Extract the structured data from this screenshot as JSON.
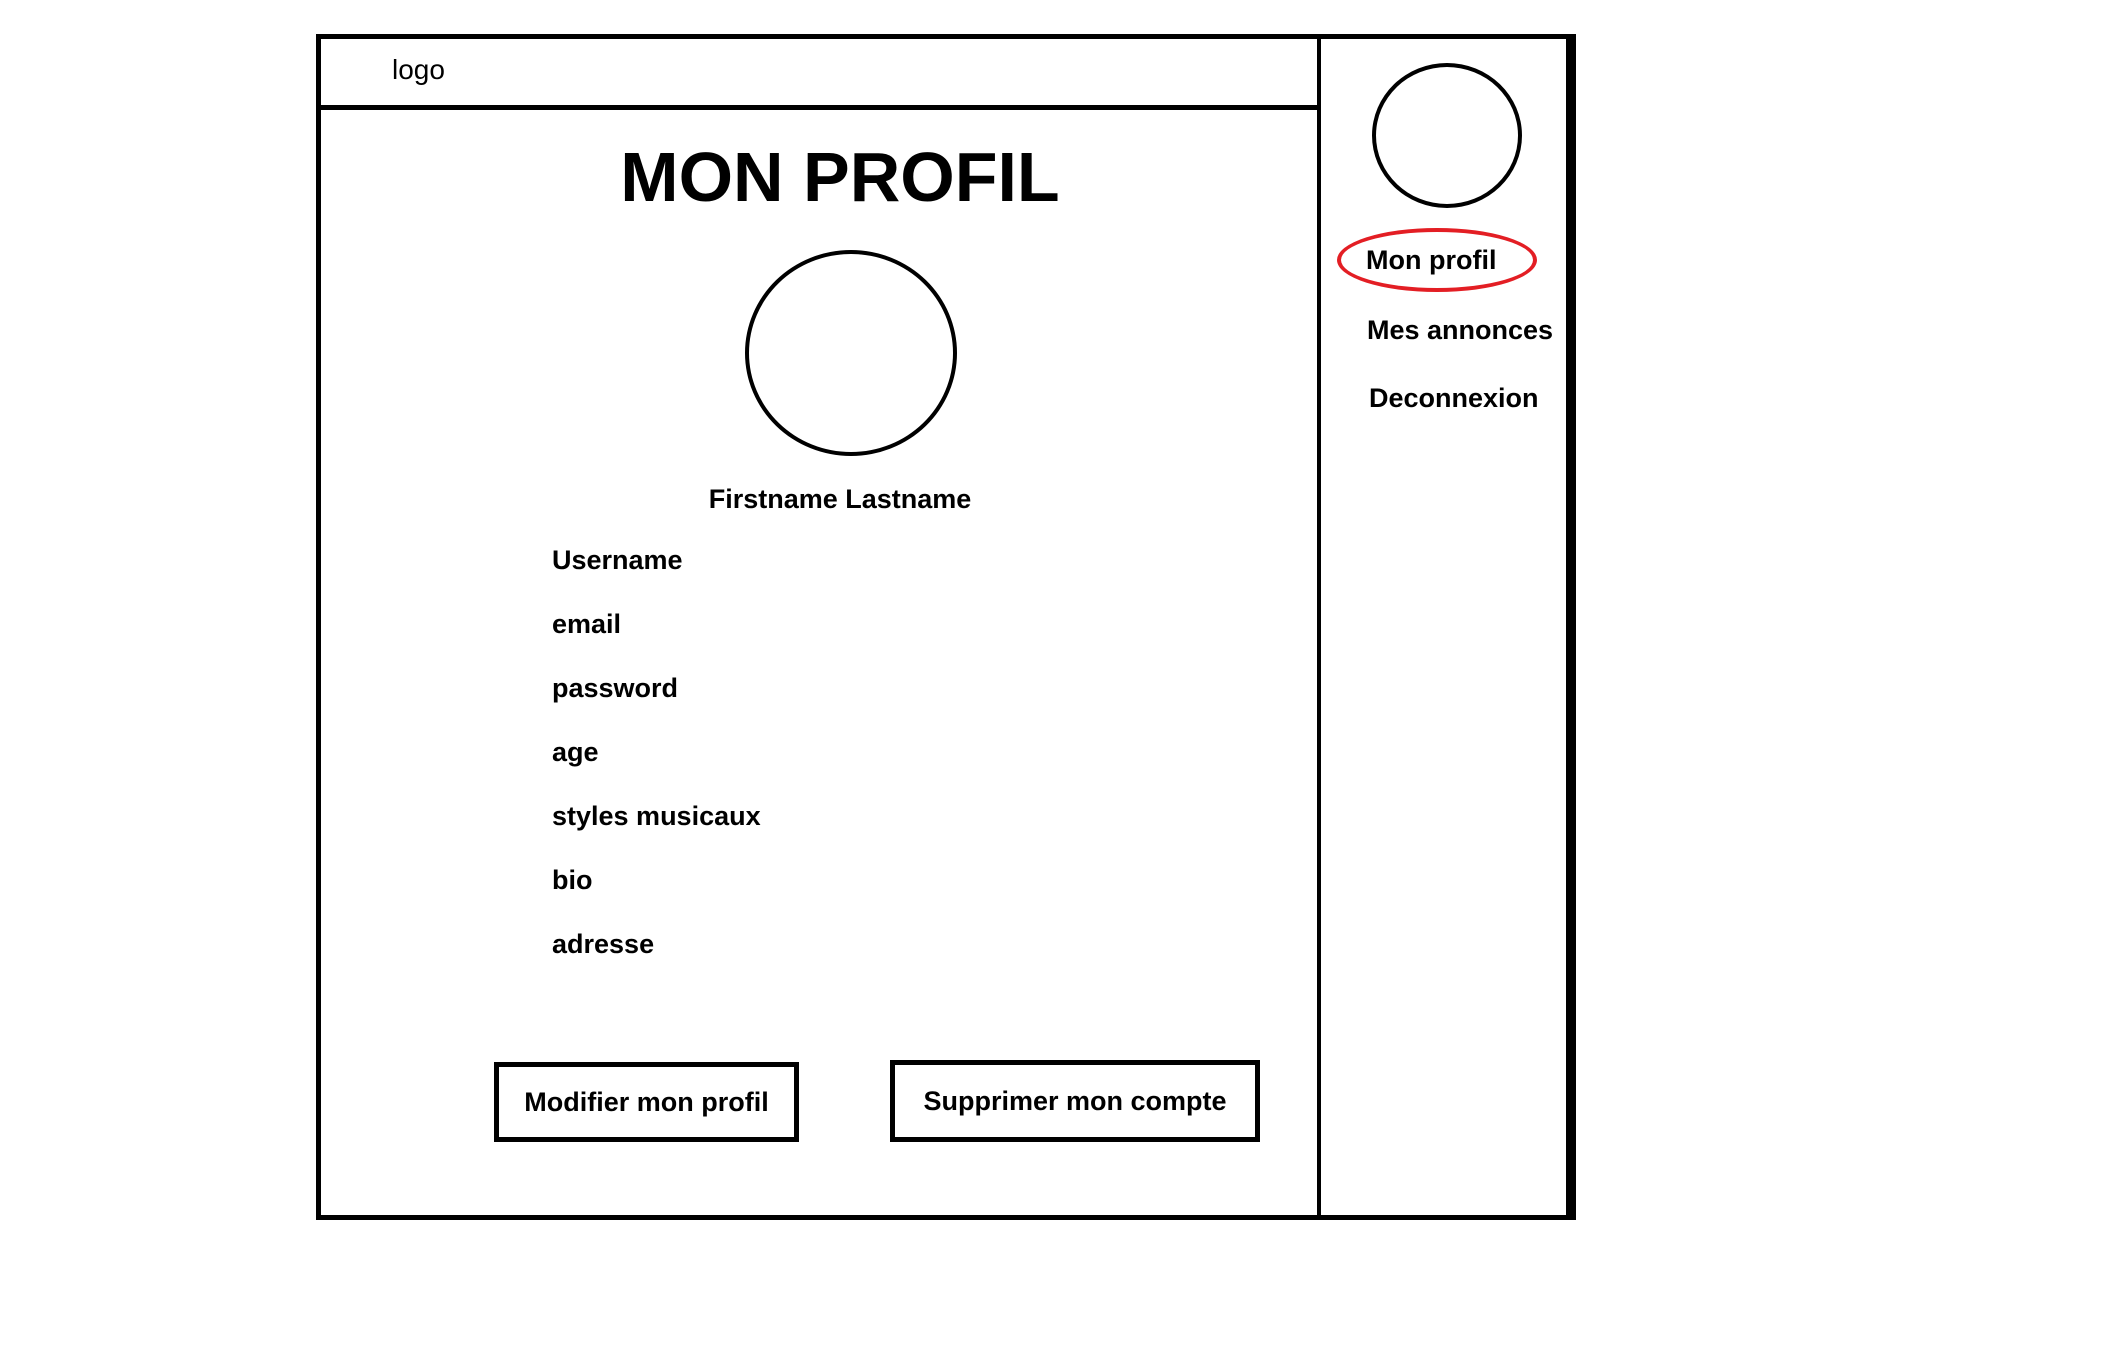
{
  "header": {
    "logo": "logo"
  },
  "main": {
    "title": "MON PROFIL",
    "name": "Firstname Lastname",
    "fields": [
      "Username",
      "email",
      "password",
      "age",
      "styles musicaux",
      "bio",
      "adresse"
    ],
    "buttons": {
      "edit": "Modifier mon profil",
      "delete": "Supprimer mon compte"
    }
  },
  "sidebar": {
    "items": [
      {
        "label": "Mon profil",
        "active": true
      },
      {
        "label": "Mes annonces"
      },
      {
        "label": "Deconnexion"
      }
    ],
    "highlight_color": "#e31e24"
  }
}
